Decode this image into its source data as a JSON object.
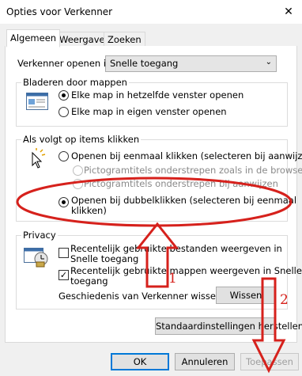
{
  "window": {
    "title": "Opties voor Verkenner",
    "close_symbol": "✕"
  },
  "tabs": [
    {
      "label": "Algemeen",
      "selected": true
    },
    {
      "label": "Weergave",
      "selected": false
    },
    {
      "label": "Zoeken",
      "selected": false
    }
  ],
  "open_in": {
    "label": "Verkenner openen in:",
    "selected": "Snelle toegang"
  },
  "browse_folders": {
    "title": "Bladeren door mappen",
    "options": [
      {
        "label": "Elke map in hetzelfde venster openen",
        "checked": true
      },
      {
        "label": "Elke map in eigen venster openen",
        "checked": false
      }
    ]
  },
  "click_items": {
    "title": "Als volgt op items klikken",
    "single_click": "Openen bij eenmaal klikken (selecteren bij aanwijzen)",
    "sub_option_1": "Pictogramtitels onderstrepen zoals in de browser",
    "sub_option_2": "Pictogramtitels onderstrepen bij aanwijzen",
    "double_click_line1": "Openen bij dubbelklikken (selecteren bij eenmaal",
    "double_click_line2": "klikken)",
    "selected": "double_click"
  },
  "privacy": {
    "title": "Privacy",
    "recent_files_line1": "Recentelijk gebruikte bestanden weergeven in",
    "recent_files_line2": "Snelle toegang",
    "recent_files_checked": false,
    "recent_folders_line1": "Recentelijk gebruikte mappen weergeven in Snelle",
    "recent_folders_line2": "toegang",
    "recent_folders_checked": true,
    "history_label": "Geschiedenis van Verkenner wissen",
    "clear_button": "Wissen"
  },
  "restore_defaults_button": "Standaardinstellingen herstellen",
  "footer": {
    "ok": "OK",
    "cancel": "Annuleren",
    "apply": "Toepassen"
  },
  "annotations": {
    "marker_1": "1",
    "marker_2": "2",
    "color": "#d6211c"
  }
}
